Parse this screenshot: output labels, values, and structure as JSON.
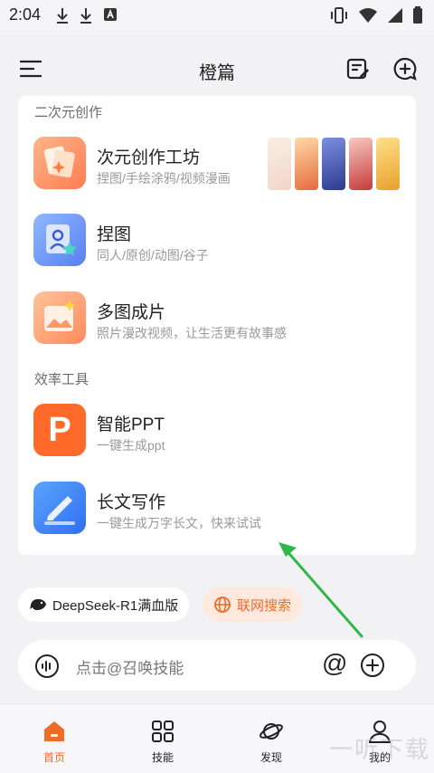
{
  "status": {
    "time": "2:04"
  },
  "header": {
    "title": "橙篇"
  },
  "sections": [
    {
      "label": "二次元创作"
    },
    {
      "label": "效率工具"
    }
  ],
  "features": [
    {
      "title": "次元创作工坊",
      "subtitle": "捏图/手绘涂鸦/视频漫画"
    },
    {
      "title": "捏图",
      "subtitle": "同人/原创/动图/谷子"
    },
    {
      "title": "多图成片",
      "subtitle": "照片漫改视频，让生活更有故事感"
    },
    {
      "title": "智能PPT",
      "subtitle": "一键生成ppt",
      "icon_letter": "P"
    },
    {
      "title": "长文写作",
      "subtitle": "一键生成万字长文，快来试试"
    }
  ],
  "chips": {
    "model": "DeepSeek-R1满血版",
    "web_search": "联网搜索"
  },
  "input": {
    "placeholder": "点击@召唤技能",
    "at": "@"
  },
  "tabs": [
    {
      "label": "首页",
      "active": true
    },
    {
      "label": "技能"
    },
    {
      "label": "发现"
    },
    {
      "label": "我的"
    }
  ],
  "watermark": "一听下载",
  "colors": {
    "accent": "#ef6b26",
    "arrow": "#2fb84a"
  }
}
